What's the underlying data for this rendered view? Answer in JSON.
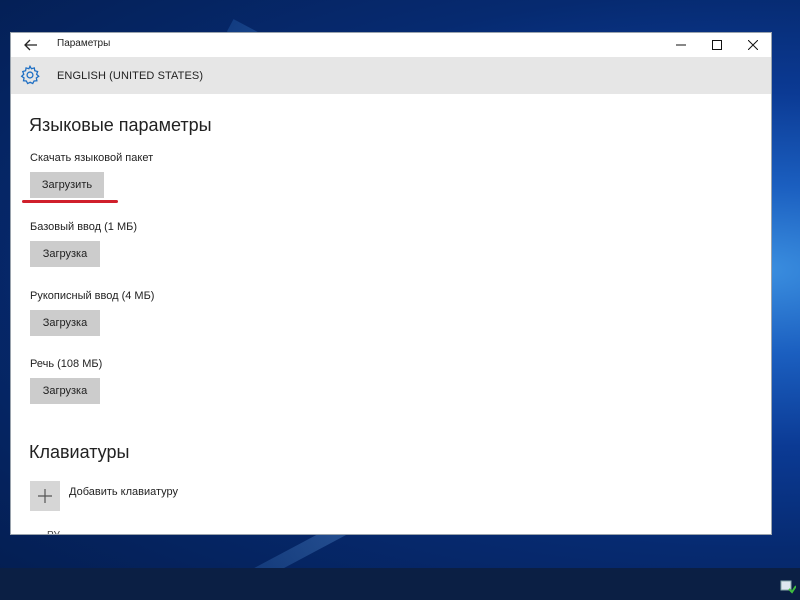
{
  "window": {
    "title": "Параметры"
  },
  "header": {
    "language": "ENGLISH (UNITED STATES)",
    "icon": "gear-icon"
  },
  "language_options": {
    "heading": "Языковые параметры",
    "items": [
      {
        "label": "Скачать языковой пакет",
        "button": "Загрузить"
      },
      {
        "label": "Базовый ввод (1 МБ)",
        "button": "Загрузка"
      },
      {
        "label": "Рукописный ввод (4 МБ)",
        "button": "Загрузка"
      },
      {
        "label": "Речь (108 МБ)",
        "button": "Загрузка"
      }
    ]
  },
  "keyboards": {
    "heading": "Клавиатуры",
    "add_label": "Добавить клавиатуру",
    "partial_item": "РУ"
  },
  "colors": {
    "accent": "#1e6fc4",
    "highlight_underline": "#d01f2b",
    "button_bg": "#cccccc",
    "header_bg": "#e6e6e6"
  }
}
